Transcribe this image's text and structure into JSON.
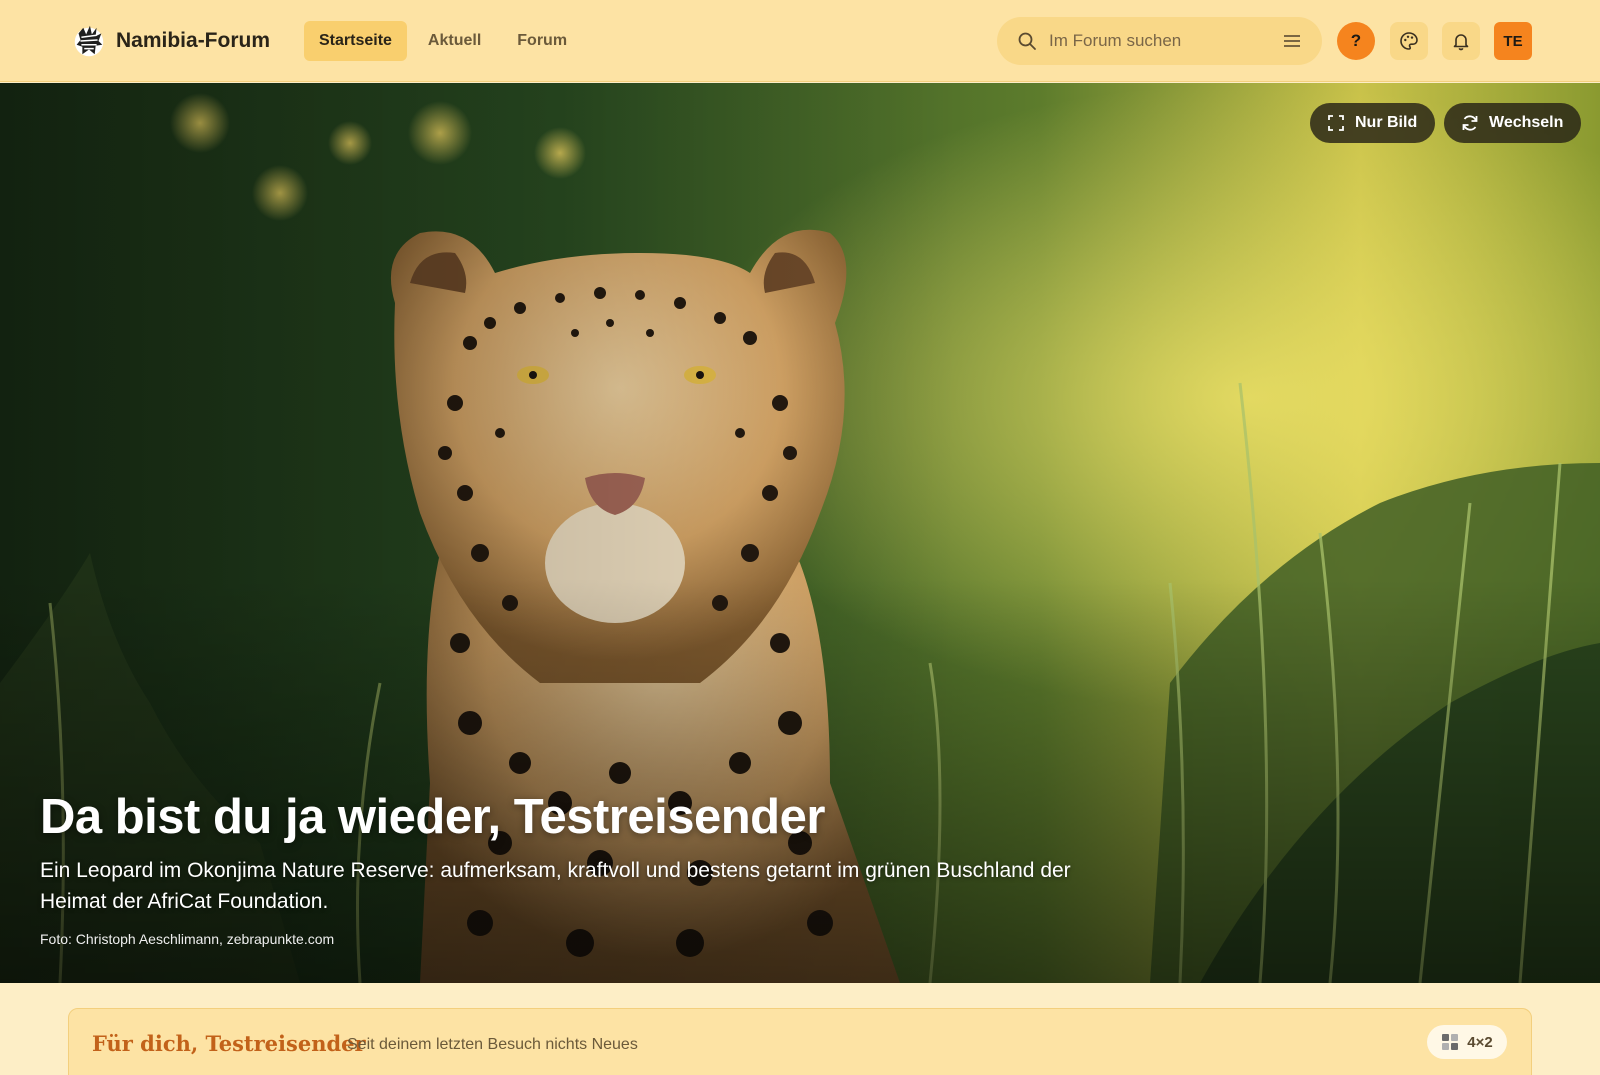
{
  "header": {
    "site_title": "Namibia-Forum",
    "nav": [
      {
        "label": "Startseite",
        "active": true
      },
      {
        "label": "Aktuell",
        "active": false
      },
      {
        "label": "Forum",
        "active": false
      }
    ],
    "search": {
      "placeholder": "Im Forum suchen",
      "value": ""
    },
    "help_label": "?",
    "avatar_initials": "TE",
    "icons": [
      "zebra-logo-icon",
      "search-icon",
      "menu-icon",
      "help-icon",
      "palette-icon",
      "bell-icon"
    ],
    "accent_color": "#f5841e",
    "header_bg": "#fde3a4"
  },
  "hero": {
    "view_image_label": "Nur Bild",
    "switch_label": "Wechseln",
    "title": "Da bist du ja wieder, Testreisender",
    "description": "Ein Leopard im Okonjima Nature Reserve: aufmerksam, kraftvoll und bestens getarnt im grünen Buschland der Heimat der AfriCat Foundation.",
    "credit": "Foto: Christoph Aeschlimann, zebrapunkte.com"
  },
  "for_you": {
    "title": "Für dich, Testreisender",
    "subtitle": "Seit deinem letzten Besuch nichts Neues",
    "grid_label": "4×2"
  }
}
